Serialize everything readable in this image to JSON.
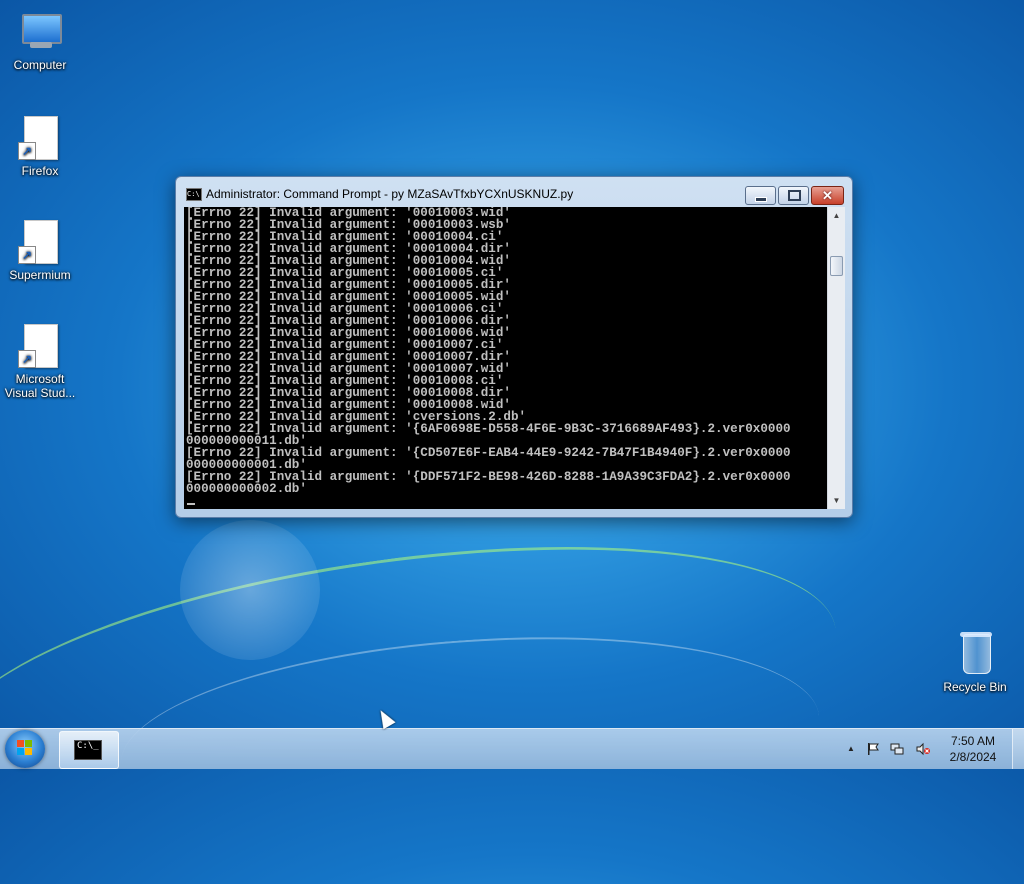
{
  "desktop": {
    "icons": [
      {
        "label": "Computer",
        "icon": "computer-icon"
      },
      {
        "label": "Firefox",
        "icon": "shortcut-file-icon"
      },
      {
        "label": "Supermium",
        "icon": "shortcut-file-icon"
      },
      {
        "label": "Microsoft Visual Stud...",
        "icon": "shortcut-file-icon"
      },
      {
        "label": "Recycle Bin",
        "icon": "recycle-bin-icon"
      }
    ]
  },
  "window": {
    "title": "Administrator:  Command Prompt - py  MZaSAvTfxbYCXnUSKNUZ.py",
    "icon_text": "C:\\",
    "minimize_glyph": "",
    "close_glyph": "✕",
    "lines": [
      "[Errno 22] Invalid argument: '00010003.wid'",
      "[Errno 22] Invalid argument: '00010003.wsb'",
      "[Errno 22] Invalid argument: '00010004.ci'",
      "[Errno 22] Invalid argument: '00010004.dir'",
      "[Errno 22] Invalid argument: '00010004.wid'",
      "[Errno 22] Invalid argument: '00010005.ci'",
      "[Errno 22] Invalid argument: '00010005.dir'",
      "[Errno 22] Invalid argument: '00010005.wid'",
      "[Errno 22] Invalid argument: '00010006.ci'",
      "[Errno 22] Invalid argument: '00010006.dir'",
      "[Errno 22] Invalid argument: '00010006.wid'",
      "[Errno 22] Invalid argument: '00010007.ci'",
      "[Errno 22] Invalid argument: '00010007.dir'",
      "[Errno 22] Invalid argument: '00010007.wid'",
      "[Errno 22] Invalid argument: '00010008.ci'",
      "[Errno 22] Invalid argument: '00010008.dir'",
      "[Errno 22] Invalid argument: '00010008.wid'",
      "[Errno 22] Invalid argument: 'cversions.2.db'",
      "[Errno 22] Invalid argument: '{6AF0698E-D558-4F6E-9B3C-3716689AF493}.2.ver0x0000",
      "000000000011.db'",
      "[Errno 22] Invalid argument: '{CD507E6F-EAB4-44E9-9242-7B47F1B4940F}.2.ver0x0000",
      "000000000001.db'",
      "[Errno 22] Invalid argument: '{DDF571F2-BE98-426D-8288-1A9A39C3FDA2}.2.ver0x0000",
      "000000000002.db'"
    ]
  },
  "taskbar": {
    "task_icon_text": "C:\\_",
    "tray": {
      "chevron": "▲",
      "flag_icon": "action-center-flag-icon",
      "network_icon": "network-icon",
      "volume_icon": "volume-muted-icon"
    },
    "clock": {
      "time": "7:50 AM",
      "date": "2/8/2024"
    }
  },
  "colors": {
    "console_bg": "#000000",
    "console_text": "#c0c0c0",
    "close_button": "#c7402a"
  }
}
